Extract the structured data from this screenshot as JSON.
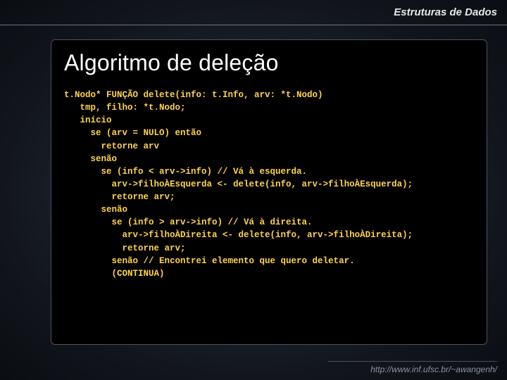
{
  "header": {
    "course": "Estruturas de Dados"
  },
  "slide": {
    "title": "Algoritmo de deleção"
  },
  "code": {
    "lines": [
      "t.Nodo* FUNÇÃO delete(info: t.Info, arv: *t.Nodo)",
      "   tmp, filho: *t.Nodo;",
      "   início",
      "     se (arv = NULO) então",
      "       retorne arv",
      "     senão",
      "       se (info < arv->info) // Vá à esquerda.",
      "         arv->filhoÀEsquerda <- delete(info, arv->filhoÀEsquerda);",
      "         retorne arv;",
      "       senão",
      "         se (info > arv->info) // Vá à direita.",
      "           arv->filhoÀDireita <- delete(info, arv->filhoÀDireita);",
      "           retorne arv;",
      "         senão // Encontrei elemento que quero deletar.",
      "         (CONTINUA)"
    ]
  },
  "footer": {
    "url": "http://www.inf.ufsc.br/~awangenh/"
  }
}
